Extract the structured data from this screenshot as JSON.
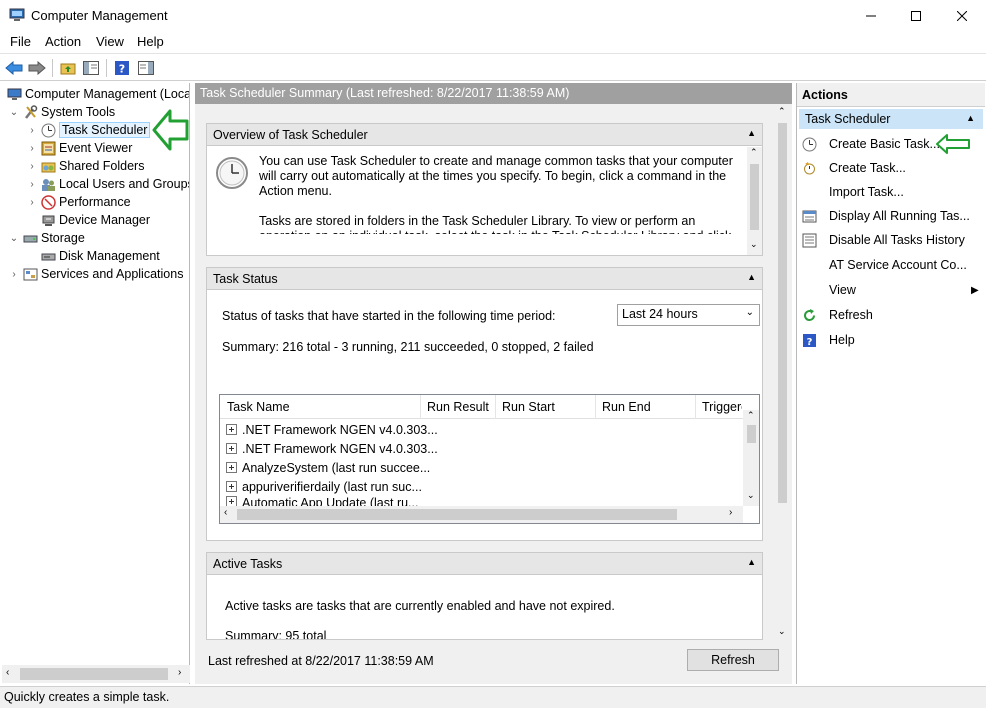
{
  "window": {
    "title": "Computer Management"
  },
  "menu": [
    "File",
    "Action",
    "View",
    "Help"
  ],
  "tree": [
    {
      "label": "Computer Management (Local",
      "level": 0,
      "arrow": "",
      "icon": "computer-icon"
    },
    {
      "label": "System Tools",
      "level": 1,
      "arrow": "⌄",
      "icon": "tools-icon"
    },
    {
      "label": "Task Scheduler",
      "level": 2,
      "arrow": "›",
      "icon": "clock-icon",
      "selected": true
    },
    {
      "label": "Event Viewer",
      "level": 2,
      "arrow": "›",
      "icon": "event-viewer-icon"
    },
    {
      "label": "Shared Folders",
      "level": 2,
      "arrow": "›",
      "icon": "shared-folder-icon"
    },
    {
      "label": "Local Users and Groups",
      "level": 2,
      "arrow": "›",
      "icon": "users-icon"
    },
    {
      "label": "Performance",
      "level": 2,
      "arrow": "›",
      "icon": "performance-icon"
    },
    {
      "label": "Device Manager",
      "level": 2,
      "arrow": "",
      "icon": "device-manager-icon"
    },
    {
      "label": "Storage",
      "level": 1,
      "arrow": "⌄",
      "icon": "storage-icon"
    },
    {
      "label": "Disk Management",
      "level": 2,
      "arrow": "",
      "icon": "disk-icon"
    },
    {
      "label": "Services and Applications",
      "level": 1,
      "arrow": "›",
      "icon": "services-icon"
    }
  ],
  "middle": {
    "header": "Task Scheduler Summary (Last refreshed: 8/22/2017 11:38:59 AM)",
    "overview": {
      "title": "Overview of Task Scheduler",
      "para1": "You can use Task Scheduler to create and manage common tasks that your computer will carry out automatically at the times you specify. To begin, click a command in the Action menu.",
      "para2": "Tasks are stored in folders in the Task Scheduler Library. To view or perform an operation on an individual task, select the task in the Task Scheduler Library and click on a command in the Action menu."
    },
    "status": {
      "title": "Task Status",
      "period_label": "Status of tasks that have started in the following time period:",
      "period_value": "Last 24 hours",
      "summary": "Summary: 216 total - 3 running, 211 succeeded, 0 stopped, 2 failed",
      "columns": [
        "Task Name",
        "Run Result",
        "Run Start",
        "Run End",
        "Triggere"
      ],
      "rows": [
        ".NET Framework NGEN v4.0.303...",
        ".NET Framework NGEN v4.0.303...",
        "AnalyzeSystem (last run succee...",
        "appuriverifierdaily (last run suc...",
        "Automatic App Update (last ru..."
      ]
    },
    "active": {
      "title": "Active Tasks",
      "desc": "Active tasks are tasks that are currently enabled and have not expired.",
      "summary": "Summary: 95 total"
    },
    "footer": {
      "last_refreshed": "Last refreshed at 8/22/2017 11:38:59 AM",
      "refresh_button": "Refresh"
    }
  },
  "actions": {
    "header": "Actions",
    "subheader": "Task Scheduler",
    "items": [
      {
        "label": "Create Basic Task...",
        "icon": "create-basic-task-icon"
      },
      {
        "label": "Create Task...",
        "icon": "create-task-icon"
      },
      {
        "label": "Import Task...",
        "icon": ""
      },
      {
        "label": "Display All Running Tas...",
        "icon": "running-tasks-icon"
      },
      {
        "label": "Disable All Tasks History",
        "icon": "history-icon"
      },
      {
        "label": "AT Service Account Co...",
        "icon": ""
      },
      {
        "label": "View",
        "icon": "",
        "submenu": true
      },
      {
        "label": "Refresh",
        "icon": "refresh-icon"
      },
      {
        "label": "Help",
        "icon": "help-icon"
      }
    ]
  },
  "statusbar": {
    "text": "Quickly creates a simple task."
  },
  "colors": {
    "accent_green": "#22a033",
    "selection_bg": "#cce4f7",
    "header_gray": "#a0a0a0"
  }
}
